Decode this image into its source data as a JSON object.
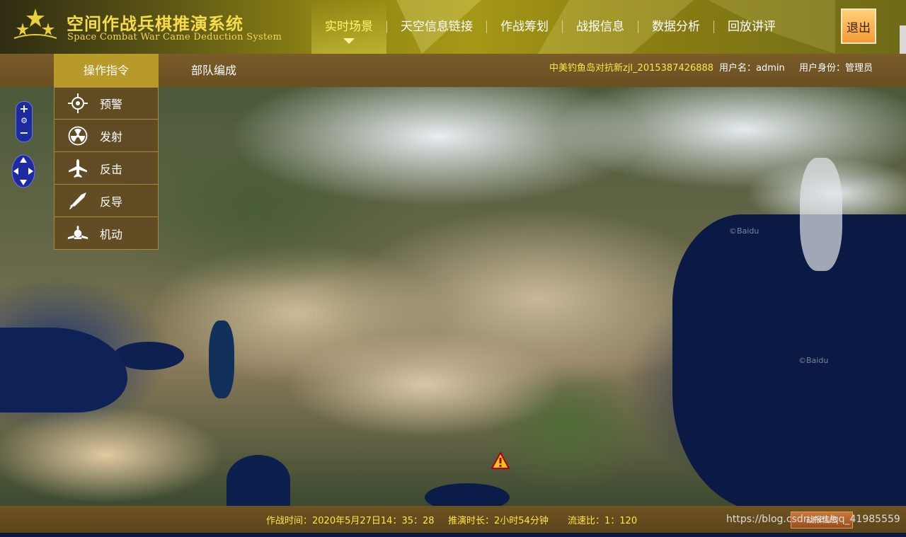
{
  "app": {
    "title_cn": "空间作战兵棋推演系统",
    "title_en": "Space  Combat  War  Came  Deduction   System"
  },
  "nav": {
    "items": [
      {
        "label": "实时场景",
        "active": true
      },
      {
        "label": "天空信息链接",
        "active": false
      },
      {
        "label": "作战筹划",
        "active": false
      },
      {
        "label": "战报信息",
        "active": false
      },
      {
        "label": "数据分析",
        "active": false
      },
      {
        "label": "回放讲评",
        "active": false
      }
    ],
    "exit_label": "退出"
  },
  "subbar": {
    "tabs": [
      {
        "label": "操作指令",
        "active": true
      },
      {
        "label": "部队编成",
        "active": false
      }
    ],
    "scenario": "中美钓鱼岛对抗新zjl_2015387426888",
    "username": "用户名：admin",
    "role": "用户身份：管理员"
  },
  "operations": [
    {
      "label": "预警",
      "icon": "crosshair-icon"
    },
    {
      "label": "发射",
      "icon": "radiation-icon"
    },
    {
      "label": "反击",
      "icon": "airplane-icon"
    },
    {
      "label": "反导",
      "icon": "missile-icon"
    },
    {
      "label": "机动",
      "icon": "satellite-icon"
    }
  ],
  "map": {
    "zoom_in": "+",
    "zoom_out": "−",
    "watermarks": [
      "©Baidu",
      "©Baidu"
    ]
  },
  "footer": {
    "combat_time": "作战时间：2020年5月27日14：35：28",
    "duration": "推演时长：2小时54分钟",
    "speed_ratio": "流速比：1：120",
    "watermark": "https://blog.csdn.net/qq_41985559",
    "button_label": "战报信息"
  },
  "colors": {
    "header_gold": "#a59816",
    "accent_yellow": "#ffe54a",
    "subbar_brown": "#7a5c2a",
    "active_tab": "#b79a29",
    "exit_orange": "#f39b35"
  }
}
